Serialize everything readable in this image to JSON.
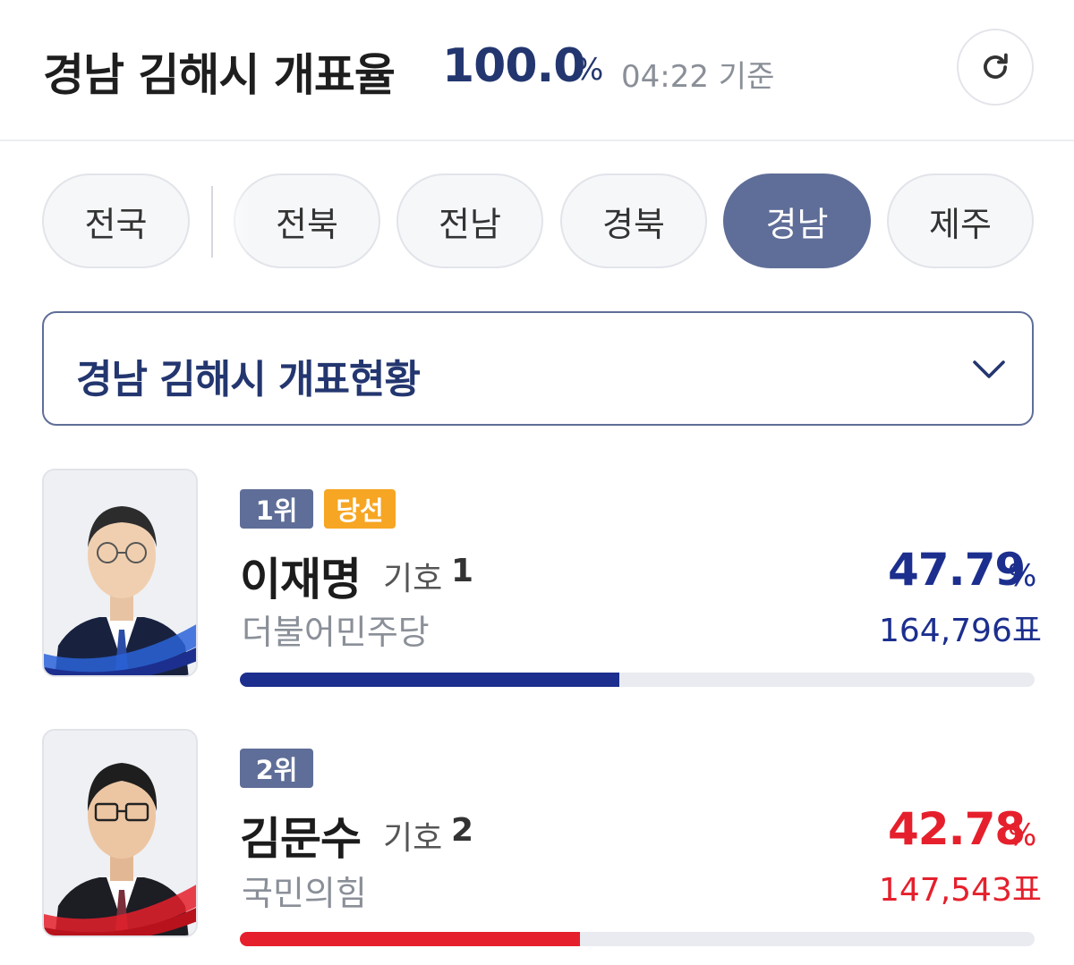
{
  "header": {
    "title": "경남 김해시 개표율",
    "rate": "100.0",
    "rate_unit": "%",
    "time": "04:22 기준"
  },
  "tabs": [
    "전국",
    "전북",
    "전남",
    "경북",
    "경남",
    "제주"
  ],
  "active_tab": "경남",
  "dropdown": {
    "label": "경남 김해시 개표현황"
  },
  "candidates": [
    {
      "rank": "1위",
      "status": "당선",
      "name": "이재명",
      "number_label": "기호",
      "number": "1",
      "party": "더불어민주당",
      "percent": "47.79",
      "percent_unit": "%",
      "votes": "164,796표",
      "share": 0.4779,
      "color": "#1c2f8e"
    },
    {
      "rank": "2위",
      "name": "김문수",
      "number_label": "기호",
      "number": "2",
      "party": "국민의힘",
      "percent": "42.78",
      "percent_unit": "%",
      "votes": "147,543표",
      "share": 0.4278,
      "color": "#e5202c"
    }
  ],
  "icons": {
    "refresh": "refresh-icon",
    "dropdown": "chevron-down-icon"
  }
}
